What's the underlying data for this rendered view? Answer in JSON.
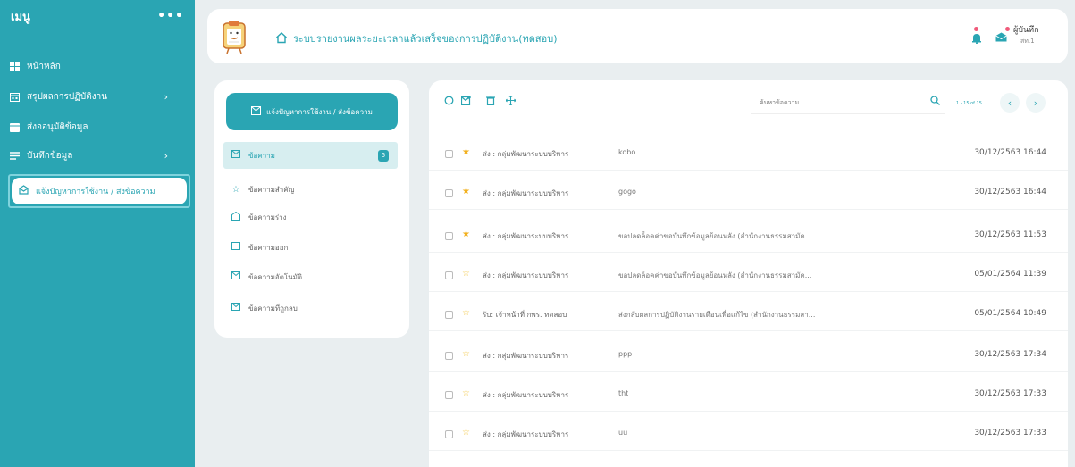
{
  "sidebar": {
    "title": "เมนู",
    "more": "•••",
    "items": [
      {
        "label": "หน้าหลัก",
        "icon": "dashboard-icon"
      },
      {
        "label": "สรุปผลการปฏิบัติงาน",
        "icon": "calendar-icon",
        "chevron": "›"
      },
      {
        "label": "ส่งออนุมัติข้อมูล",
        "icon": "calendar-check-icon"
      },
      {
        "label": "บันทึกข้อมูล",
        "icon": "list-icon",
        "chevron": "›"
      }
    ],
    "active": {
      "label": "แจ้งปัญหาการใช้งาน / ส่งข้อความ",
      "icon": "message-icon"
    }
  },
  "header": {
    "title": "ระบบรายงานผลระยะเวลาแล้วเสร็จของการปฏิบัติงาน(ทดสอบ)",
    "user_name": "ผู้บันทึก",
    "user_org": "สท.1"
  },
  "folders": {
    "compose_label": "แจ้งปัญหาการใช้งาน / ส่งข้อความ",
    "items": [
      {
        "label": "ข้อความ",
        "icon": "inbox-icon",
        "badge": "5"
      },
      {
        "label": "ข้อความสำคัญ",
        "icon": "star-icon"
      },
      {
        "label": "ข้อความร่าง",
        "icon": "draft-icon"
      },
      {
        "label": "ข้อความออก",
        "icon": "sent-icon"
      },
      {
        "label": "ข้อความอัตโนมัติ",
        "icon": "auto-icon"
      },
      {
        "label": "ข้อความที่ถูกลบ",
        "icon": "trash-mail-icon"
      }
    ]
  },
  "toolbar": {
    "search_placeholder": "ค้นหาข้อความ",
    "pager_text": "1 - 15 of 15"
  },
  "messages": [
    {
      "from": "ส่ง : กลุ่มพัฒนาระบบบริหาร",
      "subject": "kobo",
      "date": "30/12/2563 16:44",
      "starred": true
    },
    {
      "from": "ส่ง : กลุ่มพัฒนาระบบบริหาร",
      "subject": "gogo",
      "date": "30/12/2563 16:44",
      "starred": true
    },
    {
      "from": "ส่ง : กลุ่มพัฒนาระบบบริหาร",
      "subject": "ขอปลดล็อคค่าขอบันทึกข้อมูลย้อนหลัง (สำนักงานธรรมสามัค...",
      "date": "30/12/2563 11:53",
      "starred": true
    },
    {
      "from": "ส่ง : กลุ่มพัฒนาระบบบริหาร",
      "subject": "ขอปลดล็อคค่าขอบันทึกข้อมูลย้อนหลัง (สำนักงานธรรมสามัค...",
      "date": "05/01/2564 11:39",
      "starred": false
    },
    {
      "from": "รับ: เจ้าหน้าที่ กพร. ทดสอบ",
      "subject": "ส่งกลับผลการปฏิบัติงานรายเดือนเพื่อแก้ไข (สำนักงานธรรมสา...",
      "date": "05/01/2564 10:49",
      "starred": false
    },
    {
      "from": "ส่ง : กลุ่มพัฒนาระบบบริหาร",
      "subject": "ppp",
      "date": "30/12/2563 17:34",
      "starred": false
    },
    {
      "from": "ส่ง : กลุ่มพัฒนาระบบบริหาร",
      "subject": "tht",
      "date": "30/12/2563 17:33",
      "starred": false
    },
    {
      "from": "ส่ง : กลุ่มพัฒนาระบบบริหาร",
      "subject": "uu",
      "date": "30/12/2563 17:33",
      "starred": false
    }
  ],
  "colors": {
    "accent": "#2aa5b3",
    "star_on": "#f2b01e",
    "star_off": "#f2c94c"
  }
}
